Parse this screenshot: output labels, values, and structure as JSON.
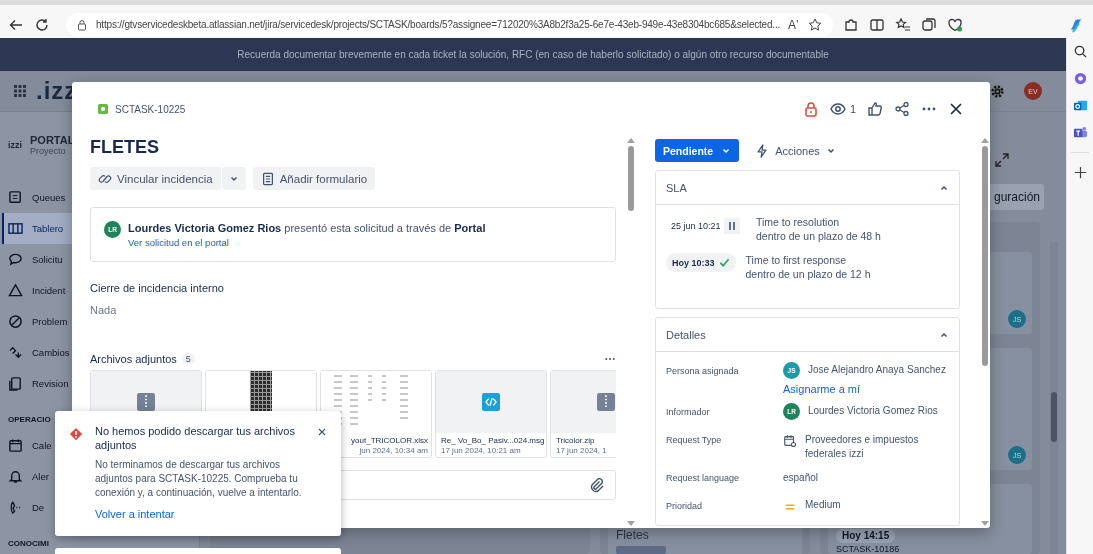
{
  "browser": {
    "url": "https://gtvservicedeskbeta.atlassian.net/jira/servicedesk/projects/SCTASK/boards/5?assignee=712020%3A8b2f3a25-6e7e-43eb-949e-43e8304bc685&selected...",
    "read_aloud": "Aʼ"
  },
  "banner": {
    "text": "Recuerda documentar brevemente en cada ticket la solución, RFC (en caso de haberlo solicitado) o algún otro recurso documentable"
  },
  "background": {
    "logo": ".izz",
    "user_initials": "EV",
    "project": {
      "logo": "izzi",
      "name": "PORTAL",
      "subtitle": "Proyecto"
    },
    "sidebar": [
      {
        "label": "Queues",
        "selected": false,
        "kind": "queues"
      },
      {
        "label": "Tablero",
        "selected": true,
        "kind": "board"
      },
      {
        "label": "Solicitu",
        "selected": false,
        "kind": "request"
      },
      {
        "label": "Incident",
        "selected": false,
        "kind": "incident"
      },
      {
        "label": "Problem",
        "selected": false,
        "kind": "problem"
      },
      {
        "label": "Cambios",
        "selected": false,
        "kind": "change"
      },
      {
        "label": "Revision",
        "selected": false,
        "kind": "review"
      }
    ],
    "section": "OPERACIO",
    "section_items": [
      {
        "label": "Cale",
        "kind": "calendar"
      },
      {
        "label": "Aler",
        "kind": "alert"
      },
      {
        "label": "De",
        "kind": "phone"
      }
    ],
    "section_2": "CONOCIMI",
    "config_button": "guración",
    "column_card_title": "Fletes",
    "card_time": "Hoy 14:15",
    "card_key": "SCTASK-10186",
    "card_assignees": [
      "JS",
      "JS"
    ]
  },
  "modal": {
    "key": "SCTASK-10225",
    "watchers": "1",
    "title": "FLETES",
    "actions": [
      {
        "label": "Vincular incidencia",
        "kind": "link"
      },
      {
        "label": "Añadir formulario",
        "kind": "form"
      }
    ],
    "reporter": {
      "initials": "LR",
      "text": "**Lourdes Victoria Gomez Rios** presentó esta solicitud a través de **Portal**",
      "link": "Ver solicitud en el portal"
    },
    "closing": {
      "label": "Cierre de incidencia interno",
      "value": "Nada"
    },
    "attachments": {
      "label": "Archivos adjuntos",
      "count": "5",
      "items": [
        {
          "kind": "zip"
        },
        {
          "kind": "image"
        },
        {
          "kind": "spreadsheet",
          "name": "yout_TRICOLOR.xlsx",
          "date": "jun 2024, 10:34 am"
        },
        {
          "kind": "email",
          "name": "Re_ Vo_Bo_ Pasiv...024.msg",
          "date": "17 jun 2024, 10:21 am"
        },
        {
          "kind": "zip",
          "name": "Tricolor.zip",
          "date": "17 jun 2024, 1"
        }
      ]
    },
    "status": "Pendiente",
    "actions_menu": "Acciones",
    "sla": {
      "title": "SLA",
      "rows": [
        {
          "kind": "paused",
          "time": "25 jun 10:21",
          "name": "Time to resolution",
          "goal": "dentro de un plazo de 48 h"
        },
        {
          "kind": "met",
          "time": "Hoy 10:33",
          "name": "Time to first response",
          "goal": "dentro de un plazo de 12 h"
        }
      ]
    },
    "details": {
      "title": "Detalles",
      "rows": [
        {
          "label": "Persona asignada",
          "kind": "person",
          "initials": "JS",
          "color": "#1d9aaa",
          "value": "Jose Alejandro Anaya Sanchez",
          "link": "Asignarme a mí"
        },
        {
          "label": "Informador",
          "kind": "person",
          "initials": "LR",
          "color": "#1f845a",
          "value": "Lourdes Victoria Gomez Rios"
        },
        {
          "label": "Request Type",
          "kind": "type",
          "value": "Proveedores e impuestos federales izzi"
        },
        {
          "label": "Request language",
          "kind": "text",
          "value": "español"
        },
        {
          "label": "Prioridad",
          "kind": "priority",
          "value": "Medium"
        }
      ]
    }
  },
  "toast": {
    "title": "No hemos podido descargar tus archivos adjuntos",
    "body": "No terminamos de descargar tus archivos adjuntos para SCTASK-10225. Comprueba tu conexión y, a continuación, vuelve a intentarlo.",
    "action": "Volver a intentar"
  }
}
